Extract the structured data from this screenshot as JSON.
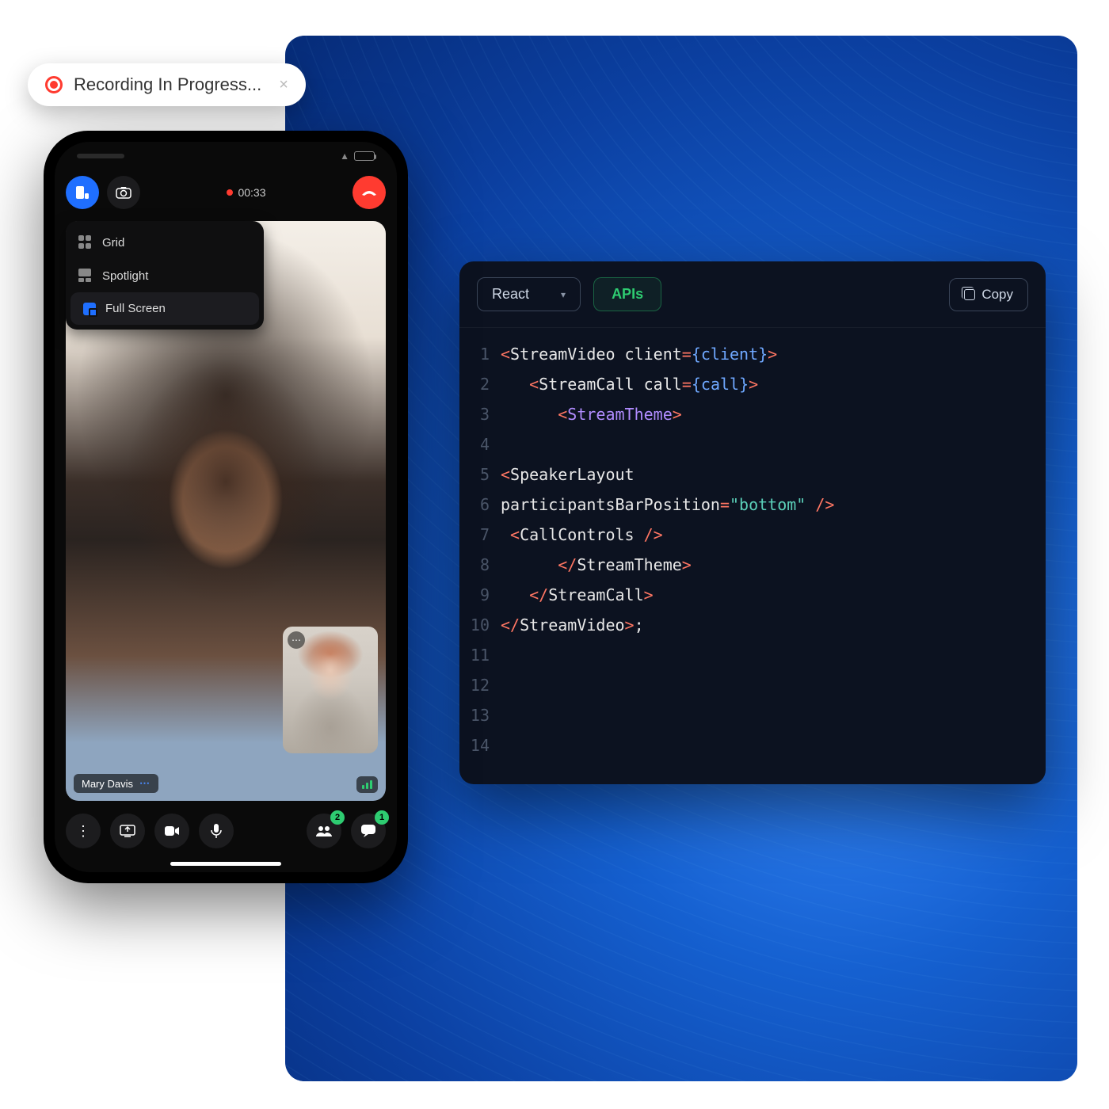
{
  "recording_pill": {
    "label": "Recording In Progress...",
    "close": "×"
  },
  "phone": {
    "rec_time": "00:33",
    "layout_menu": {
      "items": [
        {
          "id": "grid",
          "label": "Grid",
          "active": false
        },
        {
          "id": "spotlight",
          "label": "Spotlight",
          "active": false
        },
        {
          "id": "fullscreen",
          "label": "Full Screen",
          "active": true
        }
      ]
    },
    "participant_name": "Mary Davis",
    "participants_badge": "2",
    "chat_badge": "1",
    "icons": {
      "layout": "layout-icon",
      "camera_flip": "camera-flip-icon",
      "hangup": "phone-hangup-icon",
      "more": "more-icon",
      "screen_share": "screen-share-icon",
      "video": "video-icon",
      "mic": "mic-icon",
      "participants": "participants-icon",
      "chat": "chat-icon"
    }
  },
  "code_panel": {
    "framework": "React",
    "apis_label": "APIs",
    "copy_label": "Copy",
    "lines": [
      {
        "n": 1,
        "indent": 0,
        "tokens": [
          [
            "tag-open",
            "<"
          ],
          [
            "comp",
            "StreamVideo"
          ],
          [
            " ",
            " "
          ],
          [
            "attr",
            "client"
          ],
          [
            "eq",
            "="
          ],
          [
            "expr",
            "{client}"
          ],
          [
            "tag-open",
            ">"
          ]
        ]
      },
      {
        "n": 2,
        "indent": 1,
        "tokens": [
          [
            "tag-open",
            "<"
          ],
          [
            "comp",
            "StreamCall"
          ],
          [
            " ",
            " "
          ],
          [
            "attr",
            "call"
          ],
          [
            "eq",
            "="
          ],
          [
            "expr",
            "{call}"
          ],
          [
            "tag-open",
            ">"
          ]
        ]
      },
      {
        "n": 3,
        "indent": 2,
        "tokens": [
          [
            "tag-open",
            "<"
          ],
          [
            "kw-purple",
            "StreamTheme"
          ],
          [
            "tag-open",
            ">"
          ]
        ]
      },
      {
        "n": 4,
        "indent": 0,
        "tokens": []
      },
      {
        "n": 5,
        "indent": 0,
        "tokens": [
          [
            "tag-open",
            "<"
          ],
          [
            "comp",
            "SpeakerLayout"
          ]
        ]
      },
      {
        "n": 6,
        "indent": 0,
        "tokens": [
          [
            "attr",
            "participantsBarPosition"
          ],
          [
            "eq",
            "="
          ],
          [
            "str",
            "\"bottom\""
          ],
          [
            " ",
            " "
          ],
          [
            "tag-open",
            "/>"
          ]
        ]
      },
      {
        "n": 7,
        "indent": 0,
        "tokens": [
          [
            " ",
            " "
          ],
          [
            "tag-open",
            "<"
          ],
          [
            "comp",
            "CallControls"
          ],
          [
            " ",
            " "
          ],
          [
            "tag-open",
            "/>"
          ]
        ]
      },
      {
        "n": 8,
        "indent": 2,
        "tokens": [
          [
            "tag-close",
            "</"
          ],
          [
            "comp",
            "StreamTheme"
          ],
          [
            "tag-close",
            ">"
          ]
        ]
      },
      {
        "n": 9,
        "indent": 1,
        "tokens": [
          [
            "tag-close",
            "</"
          ],
          [
            "comp",
            "StreamCall"
          ],
          [
            "tag-close",
            ">"
          ]
        ]
      },
      {
        "n": 10,
        "indent": 0,
        "tokens": [
          [
            "tag-close",
            "</"
          ],
          [
            "comp",
            "StreamVideo"
          ],
          [
            "tag-close",
            ">"
          ],
          [
            "comp",
            ";"
          ]
        ]
      },
      {
        "n": 11,
        "indent": 0,
        "tokens": []
      },
      {
        "n": 12,
        "indent": 0,
        "tokens": []
      },
      {
        "n": 13,
        "indent": 0,
        "tokens": []
      },
      {
        "n": 14,
        "indent": 0,
        "tokens": []
      }
    ]
  }
}
